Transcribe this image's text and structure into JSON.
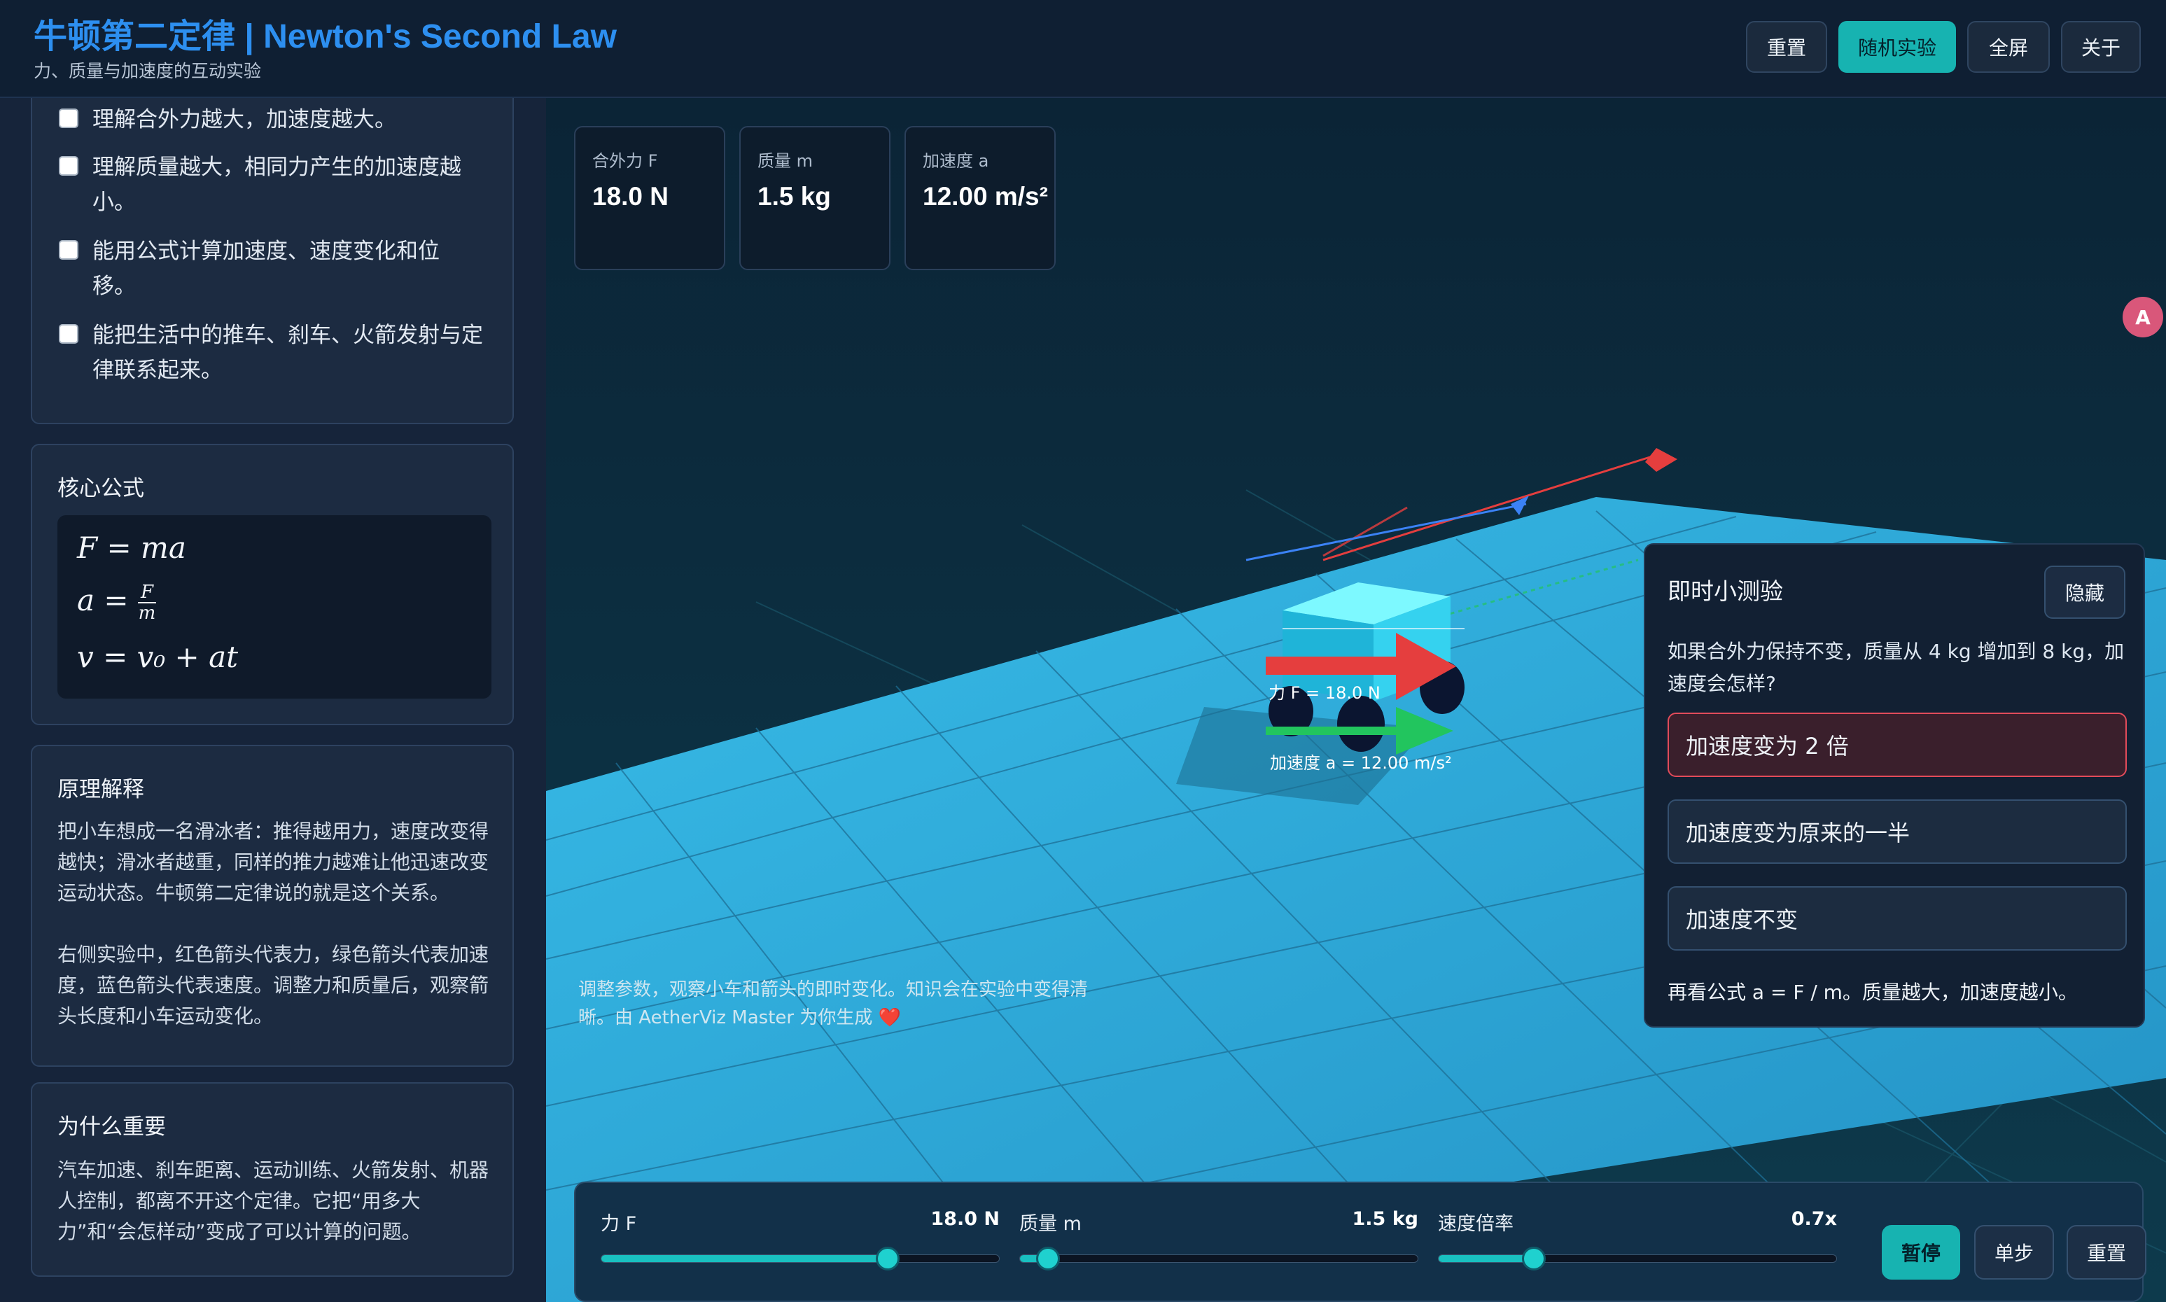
{
  "header": {
    "title": "牛顿第二定律 | Newton's Second Law",
    "subtitle": "力、质量与加速度的互动实验",
    "buttons": {
      "reset": "重置",
      "random": "随机实验",
      "fullscreen": "全屏",
      "about": "关于"
    }
  },
  "sidebar": {
    "goals": [
      "理解合外力越大，加速度越大。",
      "理解质量越大，相同力产生的加速度越小。",
      "能用公式计算加速度、速度变化和位移。",
      "能把生活中的推车、刹车、火箭发射与定律联系起来。"
    ],
    "formula": {
      "title": "核心公式",
      "lines": [
        "F = ma",
        "a = F / m",
        "v = v₀ + at"
      ]
    },
    "principle": {
      "title": "原理解释",
      "p1": "把小车想成一名滑冰者：推得越用力，速度改变得越快；滑冰者越重，同样的推力越难让他迅速改变运动状态。牛顿第二定律说的就是这个关系。",
      "p2": "右侧实验中，红色箭头代表力，绿色箭头代表加速度，蓝色箭头代表速度。调整力和质量后，观察箭头长度和小车运动变化。"
    },
    "importance": {
      "title": "为什么重要",
      "text": "汽车加速、刹车距离、运动训练、火箭发射、机器人控制，都离不开这个定律。它把“用多大力”和“会怎样动”变成了可以计算的问题。"
    }
  },
  "stats": [
    {
      "label": "合外力 F",
      "value": "18.0 N"
    },
    {
      "label": "质量 m",
      "value": "1.5 kg"
    },
    {
      "label": "加速度 a",
      "value": "12.00 m/s²"
    }
  ],
  "scene": {
    "force_label": "力 F = 18.0 N",
    "accel_label": "加速度 a = 12.00 m/s²",
    "hint": "调整参数，观察小车和箭头的即时变化。知识会在实验中变得清晰。由 AetherViz Master 为你生成 ❤️",
    "colors": {
      "force": "#e53e3e",
      "acceleration": "#22c55e",
      "velocity": "#3b82f6",
      "floor": "#2aa9dc",
      "cart": "#39d8f0"
    }
  },
  "quiz": {
    "title": "即时小测验",
    "hide_label": "隐藏",
    "question": "如果合外力保持不变，质量从 4 kg 增加到 8 kg，加速度会怎样?",
    "options": [
      "加速度变为 2 倍",
      "加速度变为原来的一半",
      "加速度不变"
    ],
    "selected_wrong": 0,
    "feedback": "再看公式 a = F / m。质量越大，加速度越小。"
  },
  "controls": {
    "sliders": [
      {
        "label": "力 F",
        "value_text": "18.0 N",
        "level": 0.72
      },
      {
        "label": "质量 m",
        "value_text": "1.5 kg",
        "level": 0.07
      },
      {
        "label": "速度倍率",
        "value_text": "0.7x",
        "level": 0.24
      }
    ],
    "buttons": {
      "pause": "暂停",
      "step": "单步",
      "reset": "重置"
    }
  },
  "translate_icon_glyph": "A"
}
